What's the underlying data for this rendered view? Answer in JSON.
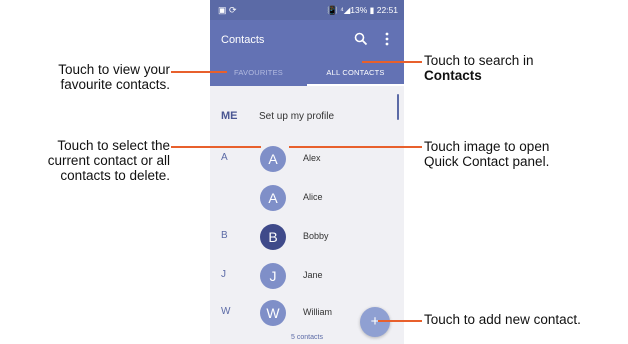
{
  "status_bar": {
    "icons_left": "▣ ⟳",
    "indicators": "📳 ⁴◢13% ▮",
    "time": "22:51"
  },
  "toolbar": {
    "title": "Contacts"
  },
  "tabs": [
    {
      "label": "FAVOURITES"
    },
    {
      "label": "ALL CONTACTS"
    }
  ],
  "me_row": {
    "letter": "ME",
    "text": "Set up my profile"
  },
  "contacts": [
    {
      "section": "A",
      "initial": "A",
      "name": "Alex"
    },
    {
      "section": "",
      "initial": "A",
      "name": "Alice"
    },
    {
      "section": "B",
      "initial": "B",
      "name": "Bobby"
    },
    {
      "section": "J",
      "initial": "J",
      "name": "Jane"
    },
    {
      "section": "W",
      "initial": "W",
      "name": "William"
    }
  ],
  "footer": {
    "count": "5 contacts"
  },
  "fab": {
    "symbol": "+"
  },
  "callouts": {
    "favourites_line1": "Touch to view your",
    "favourites_line2": "favourite contacts.",
    "search_line1": "Touch to search in",
    "search_line2": "Contacts",
    "delete_line1": "Touch to select the",
    "delete_line2": "current contact or all",
    "delete_line3": "contacts to delete.",
    "quick_line1": "Touch image to open",
    "quick_line2": "Quick Contact panel.",
    "add": "Touch to add new contact."
  },
  "colors": {
    "status_bar": "#5b6aa6",
    "toolbar": "#6372b4",
    "avatar": "#7f8fc8",
    "avatar_selected": "#3f4a8a",
    "fab": "#8fa0d2",
    "leader_line": "#e8602c"
  }
}
